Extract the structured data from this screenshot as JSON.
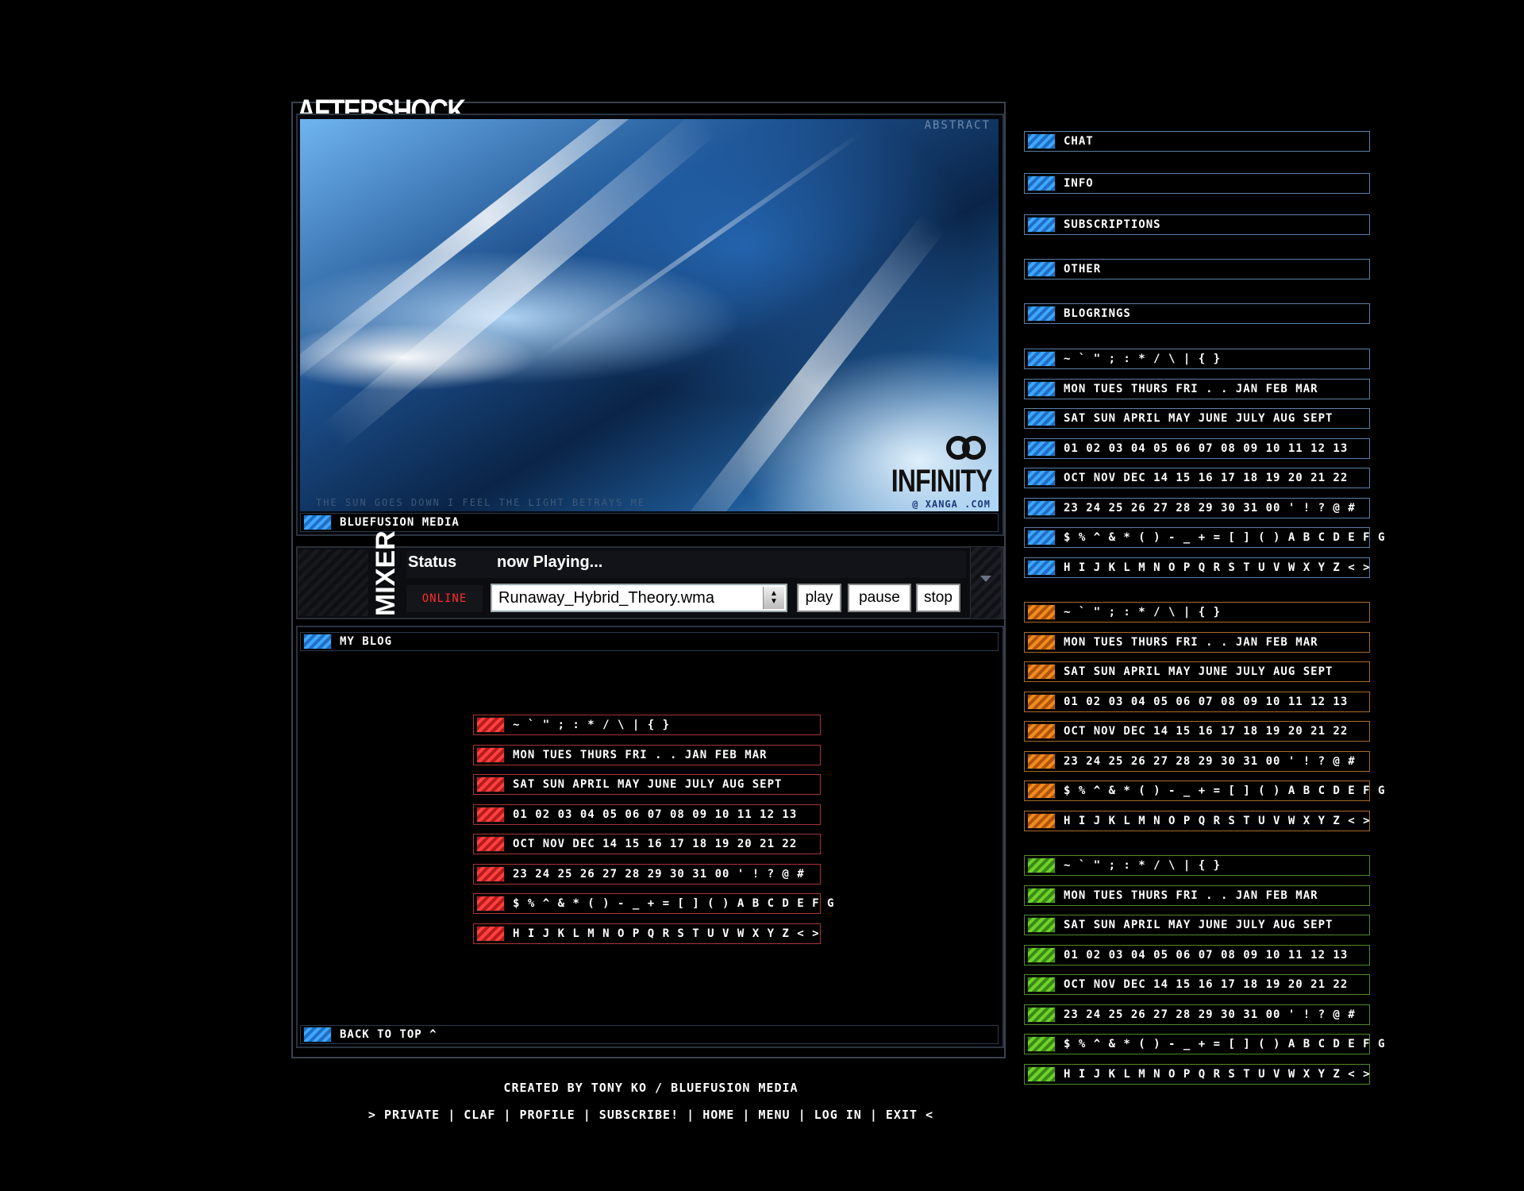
{
  "header": {
    "title": "AFTERSHOCK"
  },
  "hero": {
    "watermark": "ABSTRACT",
    "lyrics": "THE SUN GOES DOWN   I FEEL THE LIGHT   BETRAYS ME",
    "brand": "INFINITY",
    "brand_url": "@ XANGA .COM",
    "caption": "BLUEFUSION MEDIA"
  },
  "mixer": {
    "label": "MIXER",
    "status_label": "Status",
    "now_playing": "now Playing...",
    "online": "ONLINE",
    "track": "Runaway_Hybrid_Theory.wma",
    "play": "play",
    "pause": "pause",
    "stop": "stop"
  },
  "blog": {
    "title": "MY BLOG",
    "back_to_top": "BACK TO TOP ^"
  },
  "charset_lines": [
    "~ ` \" ; : * / \\ | { }",
    "MON TUES THURS FRI . . JAN FEB MAR",
    "SAT SUN APRIL MAY JUNE JULY AUG SEPT",
    "01 02 03 04 05 06 07 08 09 10 11 12 13",
    "OCT NOV DEC 14 15 16 17 18 19 20 21 22",
    "23 24 25 26 27 28 29 30 31 00 ' ! ? @ #",
    "$ % ^ & * ( ) - _ + = [ ] ( ) A B C D E F G",
    "H I J K L M N O P Q R S T U V W X Y Z < >"
  ],
  "sidebar": {
    "nav": [
      "CHAT",
      "INFO",
      "SUBSCRIPTIONS",
      "OTHER",
      "BLOGRINGS"
    ]
  },
  "colors": {
    "blue": "#3fa6ff",
    "orange": "#f08a22",
    "green": "#6ed12c",
    "red": "#ff4040",
    "blue_border": "#5a7fa8",
    "orange_border": "#a86a2a",
    "green_border": "#4f8a2a",
    "red_border": "#a83434"
  },
  "footer": {
    "credit": "CREATED BY TONY KO / BLUEFUSION MEDIA",
    "nav": "> PRIVATE | CLAF | PROFILE | SUBSCRIBE! | HOME | MENU | LOG IN | EXIT <"
  }
}
